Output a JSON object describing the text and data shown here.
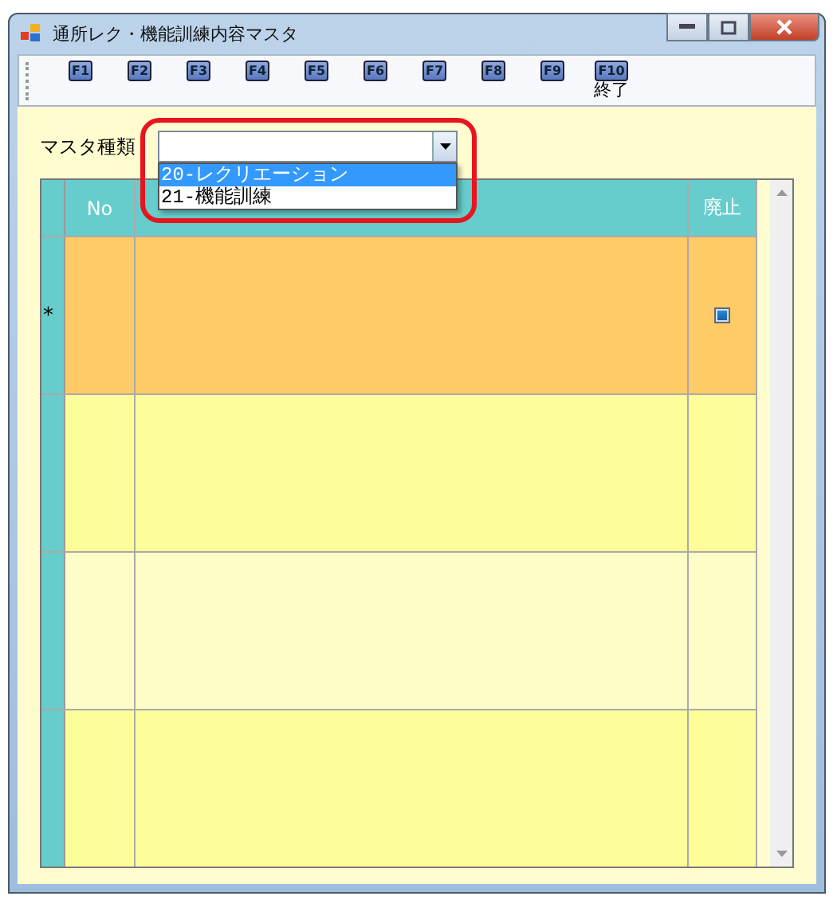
{
  "window": {
    "title": "通所レク・機能訓練内容マスタ"
  },
  "toolbar": [
    {
      "key": "F1"
    },
    {
      "key": "F2"
    },
    {
      "key": "F3"
    },
    {
      "key": "F4"
    },
    {
      "key": "F5"
    },
    {
      "key": "F6"
    },
    {
      "key": "F7"
    },
    {
      "key": "F8"
    },
    {
      "key": "F9"
    },
    {
      "key": "F10",
      "label": "終了"
    }
  ],
  "master_type": {
    "label": "マスタ種類",
    "expanded": true,
    "options": [
      {
        "text": "20-レクリエーション",
        "selected": true
      },
      {
        "text": "21-機能訓練",
        "selected": false
      }
    ]
  },
  "table": {
    "columns": [
      "No",
      "廃止"
    ],
    "rows": [
      {
        "marker": "*",
        "selected": true,
        "checkbox": true
      },
      {
        "selected": false
      },
      {
        "selected": false
      },
      {
        "selected": false
      }
    ]
  }
}
